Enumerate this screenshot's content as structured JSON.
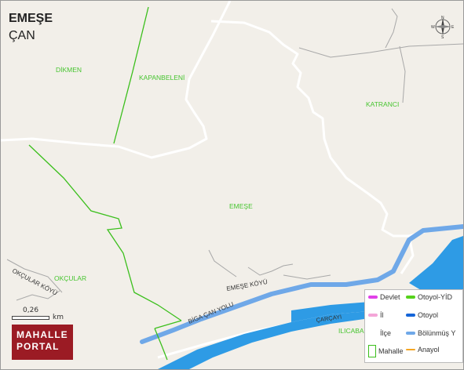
{
  "header": {
    "title": "EMEŞE",
    "subtitle": "ÇAN"
  },
  "map": {
    "place_labels": [
      "DİKMEN",
      "KAPANBELENİ",
      "KATRANCI",
      "EMEŞE",
      "OKÇULAR",
      "ILICABA"
    ],
    "road_labels": [
      "OKÇULAR KÖYÜ",
      "EMEŞE KÖYÜ",
      "BİGA ÇAN YOLU",
      "ÇARÇAYI"
    ],
    "colors": {
      "background": "#f2efe9",
      "road": "#ffffff",
      "water": "#6fa8e8",
      "river": "#2e9be5",
      "boundary": "#3bbf1c",
      "place_label": "#47c530",
      "minor_road": "#a8a8a8"
    }
  },
  "compass": {
    "north": "N",
    "south": "S",
    "east": "E",
    "west": "W",
    "icon": "compass-rose-icon"
  },
  "scale": {
    "value": "0,26",
    "unit": "km"
  },
  "logo": {
    "line1": "MAHALLE",
    "line2": "PORTAL"
  },
  "legend": {
    "items": [
      {
        "label": "Devlet",
        "color": "#e040e8",
        "kind": "line"
      },
      {
        "label": "Otoyol-YİD",
        "color": "#56d21c",
        "kind": "line"
      },
      {
        "label": "İl",
        "color": "#f4a6d8",
        "kind": "line"
      },
      {
        "label": "Otoyol",
        "color": "#1565d8",
        "kind": "line"
      },
      {
        "label": "İlçe",
        "color": "",
        "kind": "none"
      },
      {
        "label": "Bölünmüş Y",
        "color": "#6fa8e8",
        "kind": "line"
      },
      {
        "label": "Mahalle",
        "color": "#3bbf1c",
        "kind": "box"
      },
      {
        "label": "Anayol",
        "color": "#f5a623",
        "kind": "line"
      }
    ]
  }
}
